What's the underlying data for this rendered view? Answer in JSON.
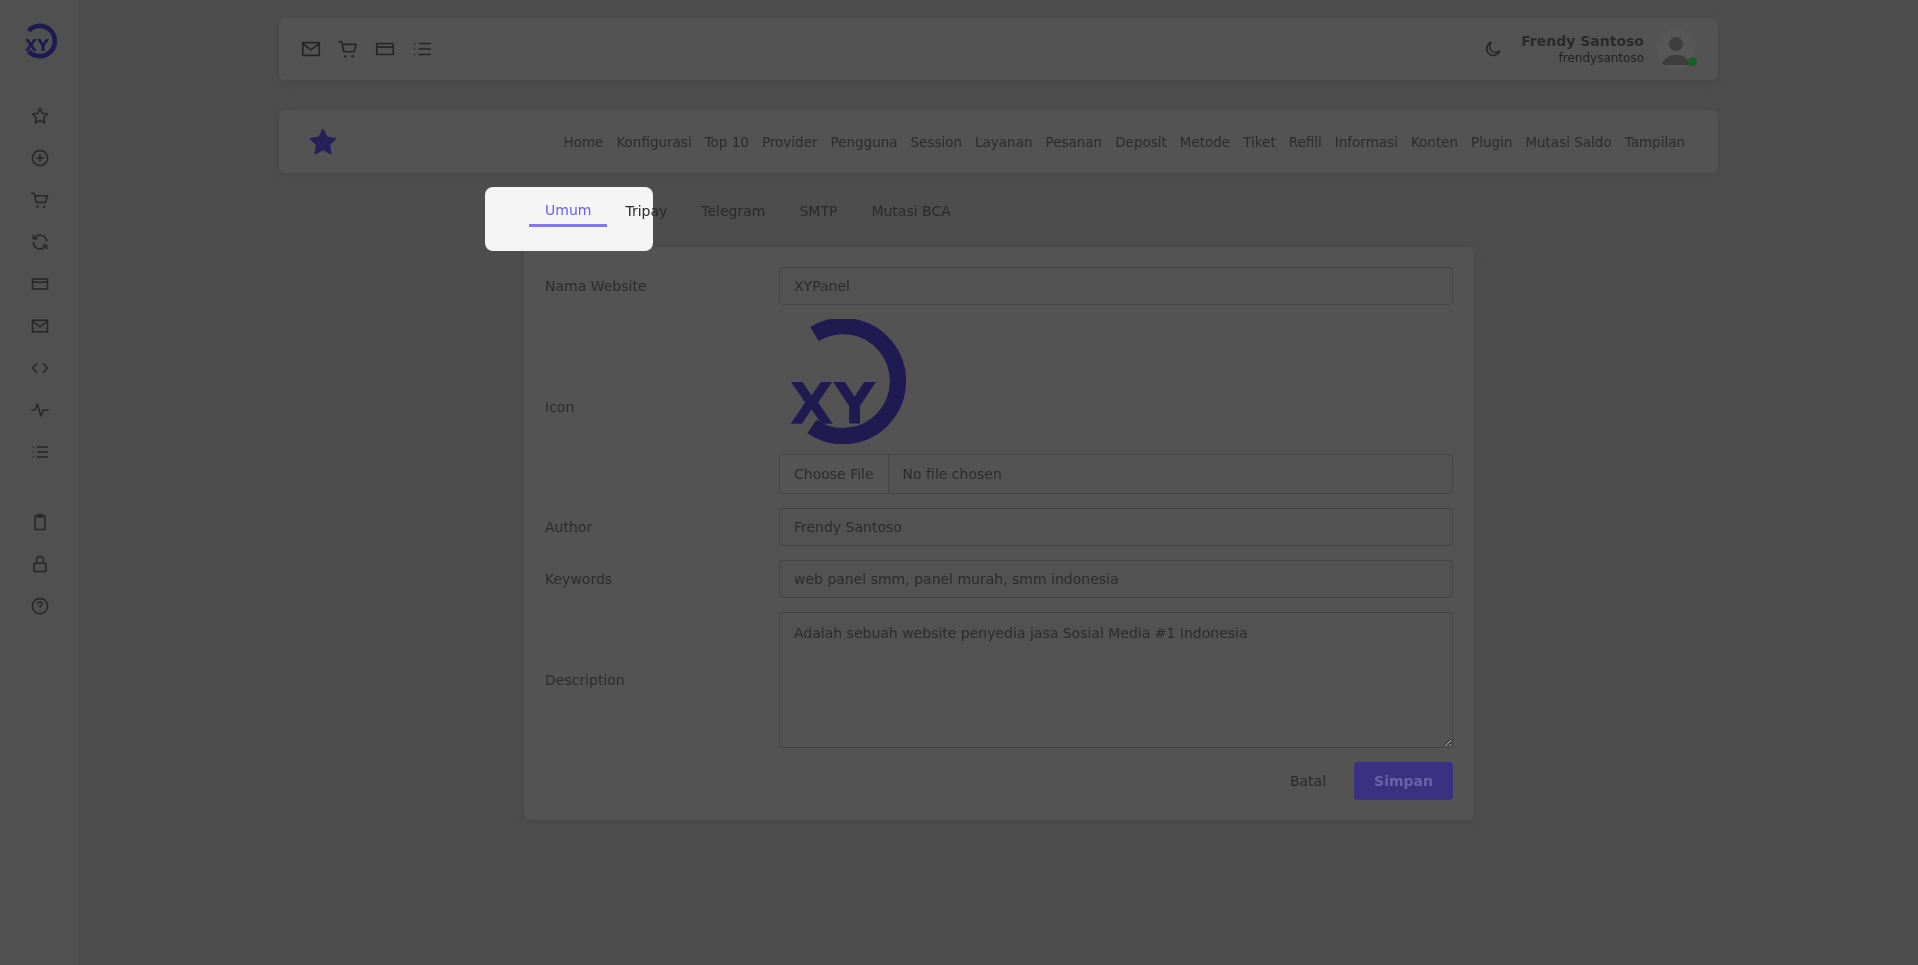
{
  "brand": {
    "mark": "XY"
  },
  "topbar": {
    "user": {
      "name": "Frendy Santoso",
      "username": "frendysantoso",
      "online": true
    }
  },
  "nav": {
    "items": [
      "Home",
      "Konfigurasi",
      "Top 10",
      "Provider",
      "Pengguna",
      "Session",
      "Layanan",
      "Pesanan",
      "Deposit",
      "Metode",
      "Tiket",
      "Refill",
      "Informasi",
      "Konten",
      "Plugin",
      "Mutasi Saldo",
      "Tampilan"
    ]
  },
  "tabs": [
    {
      "label": "Umum",
      "selected": true
    },
    {
      "label": "Tripay",
      "selected": false
    },
    {
      "label": "Telegram",
      "selected": false
    },
    {
      "label": "SMTP",
      "selected": false
    },
    {
      "label": "Mutasi BCA",
      "selected": false
    }
  ],
  "form": {
    "fields": [
      {
        "kind": "text",
        "label": "Nama Website",
        "value": "XYPanel"
      },
      {
        "kind": "image",
        "label": "Icon",
        "mark": "XY",
        "button": "Choose File",
        "file": "No file chosen"
      },
      {
        "kind": "text",
        "label": "Author",
        "value": "Frendy Santoso"
      },
      {
        "kind": "text",
        "label": "Keywords",
        "value": "web panel smm, panel murah, smm indonesia"
      },
      {
        "kind": "textarea",
        "label": "Description",
        "value": "Adalah sebuah website penyedia jasa Sosial Media #1 Indonesia"
      }
    ],
    "cancel": "Batal",
    "submit": "Simpan"
  }
}
